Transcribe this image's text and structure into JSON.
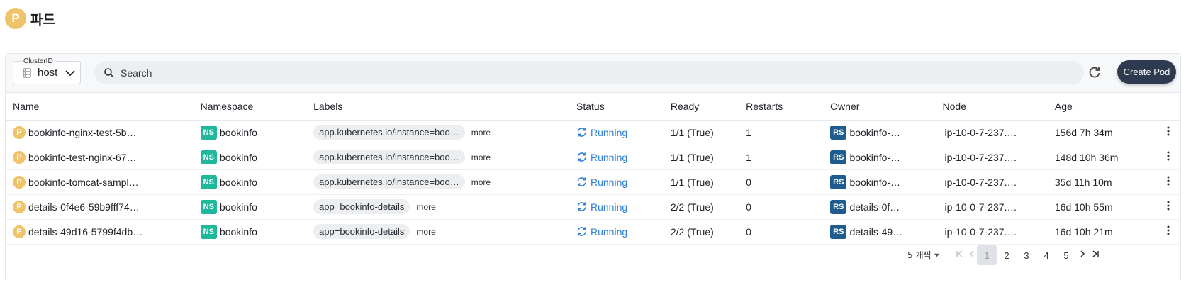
{
  "header": {
    "icon_letter": "P",
    "title": "파드"
  },
  "toolbar": {
    "cluster_label": "ClusterID",
    "cluster_value": "host",
    "search_placeholder": "Search",
    "create_label": "Create Pod"
  },
  "table": {
    "columns": [
      "Name",
      "Namespace",
      "Labels",
      "Status",
      "Ready",
      "Restarts",
      "Owner",
      "Node",
      "Age"
    ],
    "rows": [
      {
        "icon": "P",
        "name": "bookinfo-nginx-test-5b…",
        "ns_badge": "NS",
        "namespace": "bookinfo",
        "label": "app.kubernetes.io/instance=boo…",
        "more": "more",
        "status": "Running",
        "ready": "1/1 (True)",
        "restarts": "1",
        "owner_badge": "RS",
        "owner": "bookinfo-…",
        "node": "ip-10-0-7-237.…",
        "age": "156d 7h 34m"
      },
      {
        "icon": "P",
        "name": "bookinfo-test-nginx-67…",
        "ns_badge": "NS",
        "namespace": "bookinfo",
        "label": "app.kubernetes.io/instance=boo…",
        "more": "more",
        "status": "Running",
        "ready": "1/1 (True)",
        "restarts": "1",
        "owner_badge": "RS",
        "owner": "bookinfo-…",
        "node": "ip-10-0-7-237.…",
        "age": "148d 10h 36m"
      },
      {
        "icon": "P",
        "name": "bookinfo-tomcat-sampl…",
        "ns_badge": "NS",
        "namespace": "bookinfo",
        "label": "app.kubernetes.io/instance=boo…",
        "more": "more",
        "status": "Running",
        "ready": "1/1 (True)",
        "restarts": "0",
        "owner_badge": "RS",
        "owner": "bookinfo-…",
        "node": "ip-10-0-7-237.…",
        "age": "35d 11h 10m"
      },
      {
        "icon": "P",
        "name": "details-0f4e6-59b9fff74…",
        "ns_badge": "NS",
        "namespace": "bookinfo",
        "label": "app=bookinfo-details",
        "more": "more",
        "status": "Running",
        "ready": "2/2 (True)",
        "restarts": "0",
        "owner_badge": "RS",
        "owner": "details-0f…",
        "node": "ip-10-0-7-237.…",
        "age": "16d 10h 55m"
      },
      {
        "icon": "P",
        "name": "details-49d16-5799f4db…",
        "ns_badge": "NS",
        "namespace": "bookinfo",
        "label": "app=bookinfo-details",
        "more": "more",
        "status": "Running",
        "ready": "2/2 (True)",
        "restarts": "0",
        "owner_badge": "RS",
        "owner": "details-49…",
        "node": "ip-10-0-7-237.…",
        "age": "16d 10h 21m"
      }
    ]
  },
  "pagination": {
    "per_page": "5 개씩",
    "pages": [
      "1",
      "2",
      "3",
      "4",
      "5"
    ],
    "current": "1"
  },
  "icons": {
    "header": "pod-icon",
    "cluster": "server-icon",
    "search": "search-icon",
    "refresh": "refresh-icon",
    "status": "sync-icon",
    "row_menu": "kebab-menu-icon"
  },
  "colors": {
    "pod_badge": "#efc36a",
    "ns_badge": "#1fb89a",
    "rs_badge": "#1e5b8e",
    "running": "#2f7fd6",
    "create_button": "#2d3a4f"
  }
}
